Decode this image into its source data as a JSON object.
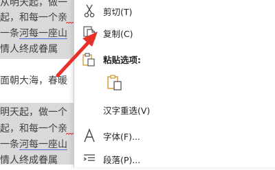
{
  "document": {
    "lines": [
      "从明天起，做一",
      "起，和每一个亲",
      "一条",
      "河每一座山",
      "情人终成眷属",
      "面朝大海，春暖",
      "明天起，做一个",
      "起，和每一个亲",
      "一条",
      "河每一座山",
      "情人终成眷属"
    ]
  },
  "menu": {
    "cut_label": "剪切(T)",
    "copy_label": "复制(C)",
    "paste_options_label": "粘贴选项:",
    "reconvert_label": "汉字重选(V)",
    "font_label": "字体(F)...",
    "paragraph_label": "段落(P)..."
  },
  "colors": {
    "arrow": "#e8302a",
    "selection": "#d9d9d9",
    "underline": "#4a6cd4",
    "paste_icon": "#d4932a"
  }
}
